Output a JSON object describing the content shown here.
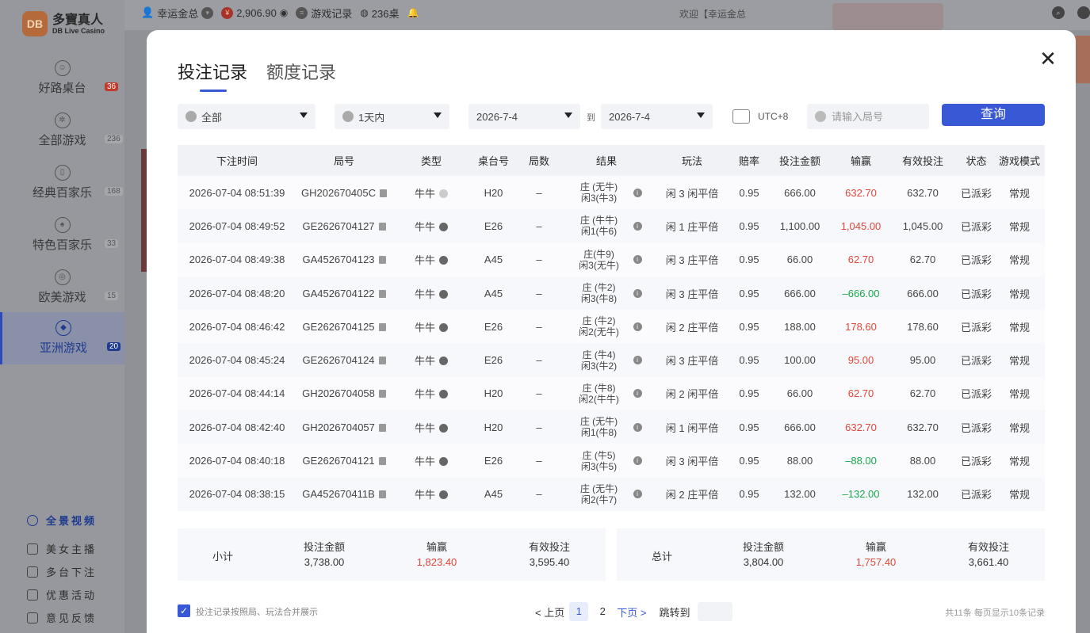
{
  "app": {
    "logo_badge": "DB",
    "logo_name": "多寶真人",
    "logo_sub": "DB Live Casino"
  },
  "topbar": {
    "user": "幸运金总",
    "balance": "2,906.90",
    "bet_record": "游戏记录",
    "tables": "236桌",
    "welcome": "欢迎【幸运金总"
  },
  "sidebar": {
    "items": [
      {
        "label": "好路桌台",
        "count": "36"
      },
      {
        "label": "全部游戏",
        "count": "236"
      },
      {
        "label": "经典百家乐",
        "count": "168"
      },
      {
        "label": "特色百家乐",
        "count": "33"
      },
      {
        "label": "欧美游戏",
        "count": "15"
      },
      {
        "label": "亚洲游戏",
        "count": "20"
      }
    ],
    "bottom": {
      "panorama": "全景视频",
      "anchor": "美女主播",
      "multi": "多台下注",
      "promo": "优惠活动",
      "feedback": "意见反馈"
    }
  },
  "modal": {
    "tabs": [
      "投注记录",
      "额度记录"
    ],
    "active_tab": "投注记录",
    "filters": {
      "game_type": "全部",
      "range": "1天内",
      "date_from": "2026-7-4",
      "to_label": "到",
      "date_to": "2026-7-4",
      "timezone": "UTC+8",
      "round_placeholder": "请输入局号",
      "query_label": "查询"
    },
    "table": {
      "headers": [
        "下注时间",
        "局号",
        "类型",
        "桌台号",
        "局数",
        "结果",
        "玩法",
        "赔率",
        "投注金额",
        "输赢",
        "有效投注",
        "状态",
        "游戏模式"
      ],
      "rows": [
        {
          "time": "2026-07-04 08:51:39",
          "round": "GH202670405C",
          "type": "牛牛",
          "table": "H20",
          "count": "–",
          "r1": "庄 (无牛)",
          "r2": "闲3(牛3)",
          "play": "闲 3 闲平倍",
          "odds": "0.95",
          "bet": "666.00",
          "win": "632.70",
          "win_class": "win",
          "valid": "632.70",
          "status": "已派彩",
          "mode": "常规"
        },
        {
          "time": "2026-07-04 08:49:52",
          "round": "GE2626704127",
          "type": "牛牛",
          "table": "E26",
          "count": "–",
          "r1": "庄 (牛牛)",
          "r2": "闲1(牛6)",
          "play": "闲 1 庄平倍",
          "odds": "0.95",
          "bet": "1,100.00",
          "win": "1,045.00",
          "win_class": "win",
          "valid": "1,045.00",
          "status": "已派彩",
          "mode": "常规"
        },
        {
          "time": "2026-07-04 08:49:38",
          "round": "GA4526704123",
          "type": "牛牛",
          "table": "A45",
          "count": "–",
          "r1": "庄(牛9)",
          "r2": "闲3(无牛)",
          "play": "闲 3 庄平倍",
          "odds": "0.95",
          "bet": "66.00",
          "win": "62.70",
          "win_class": "win",
          "valid": "62.70",
          "status": "已派彩",
          "mode": "常规"
        },
        {
          "time": "2026-07-04 08:48:20",
          "round": "GA4526704122",
          "type": "牛牛",
          "table": "A45",
          "count": "–",
          "r1": "庄 (牛2)",
          "r2": "闲3(牛8)",
          "play": "闲 3 庄平倍",
          "odds": "0.95",
          "bet": "666.00",
          "win": "–666.00",
          "win_class": "lose",
          "valid": "666.00",
          "status": "已派彩",
          "mode": "常规"
        },
        {
          "time": "2026-07-04 08:46:42",
          "round": "GE2626704125",
          "type": "牛牛",
          "table": "E26",
          "count": "–",
          "r1": "庄 (牛2)",
          "r2": "闲2(无牛)",
          "play": "闲 2 庄平倍",
          "odds": "0.95",
          "bet": "188.00",
          "win": "178.60",
          "win_class": "win",
          "valid": "178.60",
          "status": "已派彩",
          "mode": "常规"
        },
        {
          "time": "2026-07-04 08:45:24",
          "round": "GE2626704124",
          "type": "牛牛",
          "table": "E26",
          "count": "–",
          "r1": "庄 (牛4)",
          "r2": "闲3(牛2)",
          "play": "闲 3 庄平倍",
          "odds": "0.95",
          "bet": "100.00",
          "win": "95.00",
          "win_class": "win",
          "valid": "95.00",
          "status": "已派彩",
          "mode": "常规"
        },
        {
          "time": "2026-07-04 08:44:14",
          "round": "GH2026704058",
          "type": "牛牛",
          "table": "H20",
          "count": "–",
          "r1": "庄 (牛8)",
          "r2": "闲2(牛牛)",
          "play": "闲 2 闲平倍",
          "odds": "0.95",
          "bet": "66.00",
          "win": "62.70",
          "win_class": "win",
          "valid": "62.70",
          "status": "已派彩",
          "mode": "常规"
        },
        {
          "time": "2026-07-04 08:42:40",
          "round": "GH2026704057",
          "type": "牛牛",
          "table": "H20",
          "count": "–",
          "r1": "庄 (无牛)",
          "r2": "闲1(牛8)",
          "play": "闲 1 闲平倍",
          "odds": "0.95",
          "bet": "666.00",
          "win": "632.70",
          "win_class": "win",
          "valid": "632.70",
          "status": "已派彩",
          "mode": "常规"
        },
        {
          "time": "2026-07-04 08:40:18",
          "round": "GE2626704121",
          "type": "牛牛",
          "table": "E26",
          "count": "–",
          "r1": "庄 (牛5)",
          "r2": "闲3(牛5)",
          "play": "闲 3 闲平倍",
          "odds": "0.95",
          "bet": "88.00",
          "win": "–88.00",
          "win_class": "lose",
          "valid": "88.00",
          "status": "已派彩",
          "mode": "常规"
        },
        {
          "time": "2026-07-04 08:38:15",
          "round": "GA452670411B",
          "type": "牛牛",
          "table": "A45",
          "count": "–",
          "r1": "庄 (无牛)",
          "r2": "闲2(牛7)",
          "play": "闲 2 庄平倍",
          "odds": "0.95",
          "bet": "132.00",
          "win": "–132.00",
          "win_class": "lose",
          "valid": "132.00",
          "status": "已派彩",
          "mode": "常规"
        }
      ]
    },
    "subtotal": {
      "label": "小计",
      "bet_label": "投注金额",
      "bet": "3,738.00",
      "win_label": "输赢",
      "win": "1,823.40",
      "valid_label": "有效投注",
      "valid": "3,595.40"
    },
    "total": {
      "label": "总计",
      "bet_label": "投注金额",
      "bet": "3,804.00",
      "win_label": "输赢",
      "win": "1,757.40",
      "valid_label": "有效投注",
      "valid": "3,661.40"
    },
    "footer": {
      "merge_label": "投注记录按照局、玩法合并展示",
      "prev": "< 上页",
      "pages": [
        "1",
        "2"
      ],
      "next": "下页 >",
      "jump": "跳转到",
      "summary": "共11条   每页显示10条记录"
    }
  }
}
